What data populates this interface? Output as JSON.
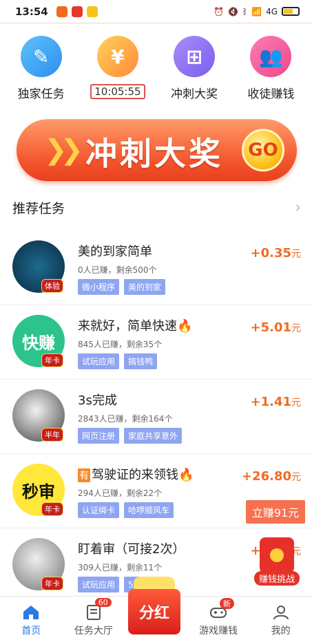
{
  "status_bar": {
    "time": "13:54",
    "network": "4G"
  },
  "top_menu": [
    {
      "label": "独家任务",
      "icon": "edit-icon",
      "color": "#3ea6f5",
      "glyph": "✎"
    },
    {
      "label": "10:05:55",
      "icon": "yen-icon",
      "color": "#fbb23a",
      "glyph": "¥",
      "is_timer": true
    },
    {
      "label": "冲刺大奖",
      "icon": "sitemap-icon",
      "color": "#8b6df3",
      "glyph": "⊞"
    },
    {
      "label": "收徒赚钱",
      "icon": "users-icon",
      "color": "#f3599b",
      "glyph": "👥"
    }
  ],
  "banner": {
    "title": "冲刺大奖",
    "go": "GO"
  },
  "section": {
    "title": "推荐任务"
  },
  "tasks": [
    {
      "title": "美的到家简单",
      "stats": "0人已赚，剩余500个",
      "tags": [
        "微小程序",
        "美的到家"
      ],
      "reward_value": "+0.35",
      "reward_unit": "元",
      "badge": "体验",
      "avatar_bg": "#0e3a5a",
      "avatar_text": ""
    },
    {
      "title": "来就好，简单快速🔥",
      "stats": "845人已赚，剩余35个",
      "tags": [
        "试玩应用",
        "搞钱鸭"
      ],
      "reward_value": "+5.01",
      "reward_unit": "元",
      "badge": "年卡",
      "avatar_bg": "#2cc38d",
      "avatar_text": "快赚"
    },
    {
      "title": "3s完成",
      "stats": "2843人已赚，剩余164个",
      "tags": [
        "网页注册",
        "家庭共享意外"
      ],
      "reward_value": "+1.41",
      "reward_unit": "元",
      "badge": "半年",
      "avatar_bg": "#d8d8d8",
      "avatar_text": ""
    },
    {
      "title": "驾驶证的来领钱🔥",
      "title_prefix": "有",
      "stats": "294人已赚，剩余22个",
      "tags": [
        "认证绑卡",
        "哈啰顺风车"
      ],
      "reward_value": "+26.80",
      "reward_unit": "元",
      "badge": "年卡",
      "avatar_bg": "#ffe83a",
      "avatar_text": "秒审"
    },
    {
      "title": "盯着审（可接2次）",
      "stats": "309人已赚，剩余11个",
      "tags": [
        "试玩应用",
        "51星球"
      ],
      "reward_value": "+4.01",
      "reward_unit": "元",
      "badge": "年卡",
      "avatar_bg": "#cccccc",
      "avatar_text": ""
    }
  ],
  "floating": {
    "earn": "立赚91元",
    "challenge": "赚钱挑战"
  },
  "bottom_nav": [
    {
      "label": "首页",
      "icon": "home-icon",
      "active": true,
      "badge": ""
    },
    {
      "label": "任务大厅",
      "icon": "task-list-icon",
      "active": false,
      "badge": "60"
    },
    {
      "label": "分红",
      "icon": "dividend-icon",
      "active": false,
      "badge": ""
    },
    {
      "label": "游戏赚钱",
      "icon": "gamepad-icon",
      "active": false,
      "badge": "新"
    },
    {
      "label": "我的",
      "icon": "user-icon",
      "active": false,
      "badge": ""
    }
  ],
  "colors": {
    "accent": "#2a7be4",
    "reward": "#f26a21",
    "tag": "#8fa5f2"
  }
}
